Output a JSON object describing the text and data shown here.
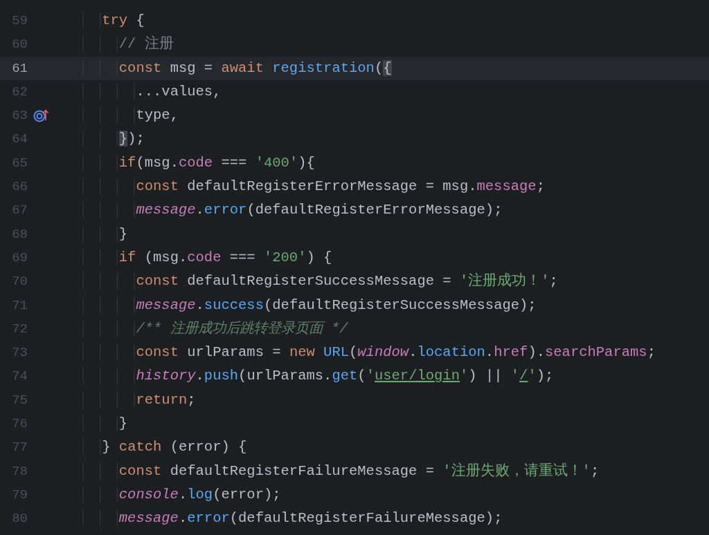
{
  "editor": {
    "lines": [
      {
        "number": "59",
        "current": false,
        "has_marker": false,
        "tokens": [
          {
            "kind": "kw",
            "text": "    try"
          },
          {
            "kind": "id",
            "text": " {"
          }
        ]
      },
      {
        "number": "60",
        "current": false,
        "has_marker": false,
        "tokens": [
          {
            "kind": "cmt",
            "text": "      // 注册"
          }
        ]
      },
      {
        "number": "61",
        "current": true,
        "has_marker": false,
        "tokens": [
          {
            "kind": "kw",
            "text": "      const"
          },
          {
            "kind": "id",
            "text": " msg = "
          },
          {
            "kind": "kw",
            "text": "await"
          },
          {
            "kind": "fn",
            "text": " registration"
          },
          {
            "kind": "id",
            "text": "("
          },
          {
            "kind": "brace",
            "text": "{"
          }
        ]
      },
      {
        "number": "62",
        "current": false,
        "has_marker": false,
        "tokens": [
          {
            "kind": "id",
            "text": "        ...values,"
          }
        ]
      },
      {
        "number": "63",
        "current": false,
        "has_marker": true,
        "tokens": [
          {
            "kind": "id",
            "text": "        type,"
          }
        ]
      },
      {
        "number": "64",
        "current": false,
        "has_marker": false,
        "tokens": [
          {
            "kind": "brace",
            "text": "      }"
          },
          {
            "kind": "id",
            "text": ");"
          }
        ]
      },
      {
        "number": "65",
        "current": false,
        "has_marker": false,
        "tokens": [
          {
            "kind": "kw",
            "text": "      if"
          },
          {
            "kind": "id",
            "text": "(msg."
          },
          {
            "kind": "prop",
            "text": "code"
          },
          {
            "kind": "id",
            "text": " === "
          },
          {
            "kind": "str",
            "text": "'400'"
          },
          {
            "kind": "id",
            "text": "){"
          }
        ]
      },
      {
        "number": "66",
        "current": false,
        "has_marker": false,
        "tokens": [
          {
            "kind": "kw",
            "text": "        const"
          },
          {
            "kind": "id",
            "text": " defaultRegisterErrorMessage = msg."
          },
          {
            "kind": "prop",
            "text": "message"
          },
          {
            "kind": "id",
            "text": ";"
          }
        ]
      },
      {
        "number": "67",
        "current": false,
        "has_marker": false,
        "tokens": [
          {
            "kind": "gvar",
            "text": "        message"
          },
          {
            "kind": "id",
            "text": "."
          },
          {
            "kind": "fn",
            "text": "error"
          },
          {
            "kind": "id",
            "text": "(defaultRegisterErrorMessage);"
          }
        ]
      },
      {
        "number": "68",
        "current": false,
        "has_marker": false,
        "tokens": [
          {
            "kind": "id",
            "text": "      }"
          }
        ]
      },
      {
        "number": "69",
        "current": false,
        "has_marker": false,
        "tokens": [
          {
            "kind": "kw",
            "text": "      if"
          },
          {
            "kind": "id",
            "text": " (msg."
          },
          {
            "kind": "prop",
            "text": "code"
          },
          {
            "kind": "id",
            "text": " === "
          },
          {
            "kind": "str",
            "text": "'200'"
          },
          {
            "kind": "id",
            "text": ") {"
          }
        ]
      },
      {
        "number": "70",
        "current": false,
        "has_marker": false,
        "tokens": [
          {
            "kind": "kw",
            "text": "        const"
          },
          {
            "kind": "id",
            "text": " defaultRegisterSuccessMessage = "
          },
          {
            "kind": "str",
            "text": "'注册成功！'"
          },
          {
            "kind": "id",
            "text": ";"
          }
        ]
      },
      {
        "number": "71",
        "current": false,
        "has_marker": false,
        "tokens": [
          {
            "kind": "gvar",
            "text": "        message"
          },
          {
            "kind": "id",
            "text": "."
          },
          {
            "kind": "fn",
            "text": "success"
          },
          {
            "kind": "id",
            "text": "(defaultRegisterSuccessMessage);"
          }
        ]
      },
      {
        "number": "72",
        "current": false,
        "has_marker": false,
        "tokens": [
          {
            "kind": "doc",
            "text": "        /** 注册成功后跳转登录页面 */"
          }
        ]
      },
      {
        "number": "73",
        "current": false,
        "has_marker": false,
        "tokens": [
          {
            "kind": "kw",
            "text": "        const"
          },
          {
            "kind": "id",
            "text": " urlParams = "
          },
          {
            "kind": "kw",
            "text": "new"
          },
          {
            "kind": "fn",
            "text": " URL"
          },
          {
            "kind": "id",
            "text": "("
          },
          {
            "kind": "gvar",
            "text": "window"
          },
          {
            "kind": "id",
            "text": "."
          },
          {
            "kind": "fn",
            "text": "location"
          },
          {
            "kind": "id",
            "text": "."
          },
          {
            "kind": "prop",
            "text": "href"
          },
          {
            "kind": "id",
            "text": ")."
          },
          {
            "kind": "prop",
            "text": "searchParams"
          },
          {
            "kind": "id",
            "text": ";"
          }
        ]
      },
      {
        "number": "74",
        "current": false,
        "has_marker": false,
        "tokens": [
          {
            "kind": "gvar",
            "text": "        history"
          },
          {
            "kind": "id",
            "text": "."
          },
          {
            "kind": "fn",
            "text": "push"
          },
          {
            "kind": "id",
            "text": "(urlParams."
          },
          {
            "kind": "fn",
            "text": "get"
          },
          {
            "kind": "id",
            "text": "("
          },
          {
            "kind": "str",
            "text": "'"
          },
          {
            "kind": "link",
            "text": "user/login"
          },
          {
            "kind": "str",
            "text": "'"
          },
          {
            "kind": "id",
            "text": ") || "
          },
          {
            "kind": "str",
            "text": "'"
          },
          {
            "kind": "link",
            "text": "/"
          },
          {
            "kind": "str",
            "text": "'"
          },
          {
            "kind": "id",
            "text": ");"
          }
        ]
      },
      {
        "number": "75",
        "current": false,
        "has_marker": false,
        "tokens": [
          {
            "kind": "kw",
            "text": "        return"
          },
          {
            "kind": "id",
            "text": ";"
          }
        ]
      },
      {
        "number": "76",
        "current": false,
        "has_marker": false,
        "tokens": [
          {
            "kind": "id",
            "text": "      }"
          }
        ]
      },
      {
        "number": "77",
        "current": false,
        "has_marker": false,
        "tokens": [
          {
            "kind": "id",
            "text": "    } "
          },
          {
            "kind": "kw",
            "text": "catch"
          },
          {
            "kind": "id",
            "text": " (error) {"
          }
        ]
      },
      {
        "number": "78",
        "current": false,
        "has_marker": false,
        "tokens": [
          {
            "kind": "kw",
            "text": "      const"
          },
          {
            "kind": "id",
            "text": " defaultRegisterFailureMessage = "
          },
          {
            "kind": "str",
            "text": "'注册失败，请重试！'"
          },
          {
            "kind": "id",
            "text": ";"
          }
        ]
      },
      {
        "number": "79",
        "current": false,
        "has_marker": false,
        "tokens": [
          {
            "kind": "gvar",
            "text": "      console"
          },
          {
            "kind": "id",
            "text": "."
          },
          {
            "kind": "fn",
            "text": "log"
          },
          {
            "kind": "id",
            "text": "(error);"
          }
        ]
      },
      {
        "number": "80",
        "current": false,
        "has_marker": false,
        "tokens": [
          {
            "kind": "gvar",
            "text": "      message"
          },
          {
            "kind": "id",
            "text": "."
          },
          {
            "kind": "fn",
            "text": "error"
          },
          {
            "kind": "id",
            "text": "(defaultRegisterFailureMessage);"
          }
        ]
      }
    ]
  }
}
